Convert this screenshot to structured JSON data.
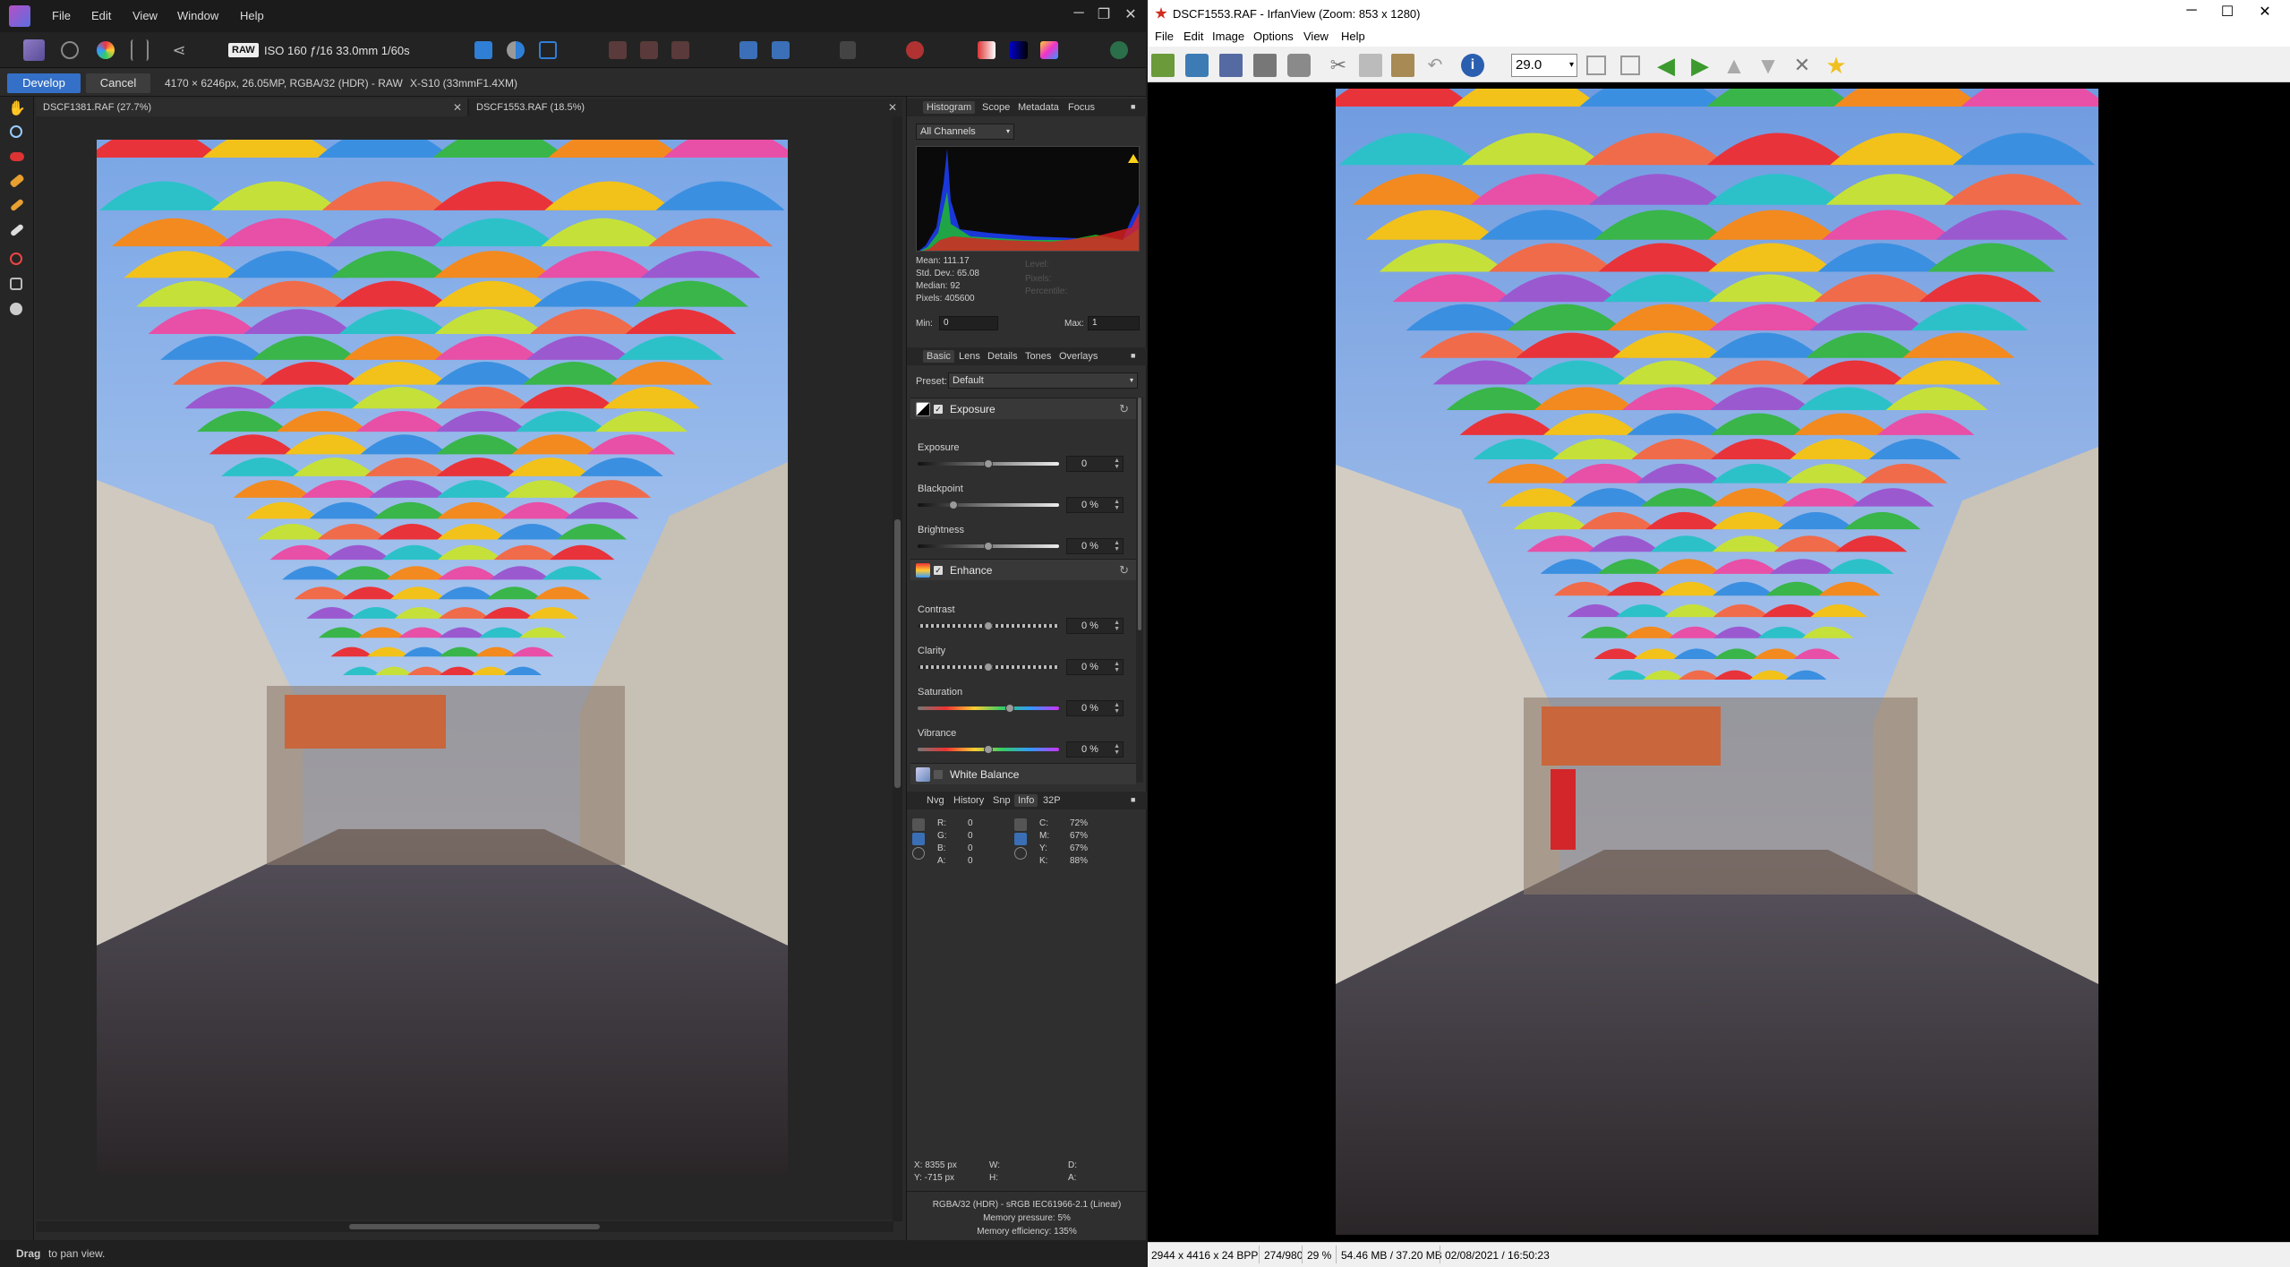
{
  "affinity": {
    "menu": [
      "File",
      "Edit",
      "View",
      "Window",
      "Help"
    ],
    "toolbar": {
      "raw_badge": "RAW",
      "exif": "ISO 160 ƒ/16 33.0mm 1/60s"
    },
    "context": {
      "develop_label": "Develop",
      "cancel_label": "Cancel",
      "image_info": "4170 × 6246px, 26.05MP, RGBA/32 (HDR) - RAW",
      "camera": "X-S10 (33mmF1.4XM)"
    },
    "doc_tabs": [
      {
        "label": "DSCF1381.RAF (27.7%)"
      },
      {
        "label": "DSCF1553.RAF (18.5%)"
      }
    ],
    "histogram_panel": {
      "tabs": [
        "Histogram",
        "Scope",
        "Metadata",
        "Focus"
      ],
      "channel": "All Channels",
      "stats": {
        "mean": "Mean: 111.17",
        "std": "Std. Dev.: 65.08",
        "median": "Median: 92",
        "pixels": "Pixels: 405600"
      },
      "dim_stats": {
        "levels": "Level:",
        "pixels": "Pixels:",
        "percentile": "Percentile:"
      },
      "min_label": "Min:",
      "min_value": "0",
      "max_label": "Max:",
      "max_value": "1"
    },
    "basic_panel": {
      "tabs": [
        "Basic",
        "Lens",
        "Details",
        "Tones",
        "Overlays"
      ],
      "preset_label": "Preset:",
      "preset_value": "Default",
      "exposure_group": {
        "label": "Exposure",
        "sliders": [
          {
            "label": "Exposure",
            "value": "0",
            "level": 0.5
          },
          {
            "label": "Blackpoint",
            "value": "0 %",
            "level": 0.25
          },
          {
            "label": "Brightness",
            "value": "0 %",
            "level": 0.5
          }
        ]
      },
      "enhance_group": {
        "label": "Enhance",
        "sliders": [
          {
            "label": "Contrast",
            "value": "0 %",
            "level": 0.5
          },
          {
            "label": "Clarity",
            "value": "0 %",
            "level": 0.5
          },
          {
            "label": "Saturation",
            "value": "0 %",
            "level": 0.65
          },
          {
            "label": "Vibrance",
            "value": "0 %",
            "level": 0.5
          }
        ]
      },
      "white_balance_label": "White Balance"
    },
    "info_panel": {
      "tabs": [
        "Nvg",
        "History",
        "Snp",
        "Info",
        "32P"
      ],
      "rgba": [
        {
          "label": "R:",
          "value": "0"
        },
        {
          "label": "G:",
          "value": "0"
        },
        {
          "label": "B:",
          "value": "0"
        },
        {
          "label": "A:",
          "value": "0"
        }
      ],
      "cmyk": [
        {
          "label": "C:",
          "value": "72%"
        },
        {
          "label": "M:",
          "value": "67%"
        },
        {
          "label": "Y:",
          "value": "67%"
        },
        {
          "label": "K:",
          "value": "88%"
        }
      ],
      "cursor": {
        "x": "X: 8355 px",
        "y": "Y: -715 px",
        "w": "W:",
        "h": "H:",
        "d": "D:",
        "a": "A:"
      },
      "colorspace": "RGBA/32 (HDR) - sRGB IEC61966-2.1 (Linear)",
      "memory_pressure": "Memory pressure: 5%",
      "memory_efficiency": "Memory efficiency: 135%"
    },
    "status": {
      "bold": "Drag",
      "text": "to pan view."
    }
  },
  "irfanview": {
    "title": "DSCF1553.RAF - IrfanView (Zoom: 853 x 1280)",
    "menu": [
      "File",
      "Edit",
      "Image",
      "Options",
      "View",
      "Help"
    ],
    "zoom_value": "29.0",
    "status": {
      "dims": "2944 x 4416 x 24 BPP",
      "index": "274/980",
      "zoom": "29 %",
      "size": "54.46 MB / 37.20 MB",
      "datetime": "02/08/2021 / 16:50:23"
    }
  }
}
